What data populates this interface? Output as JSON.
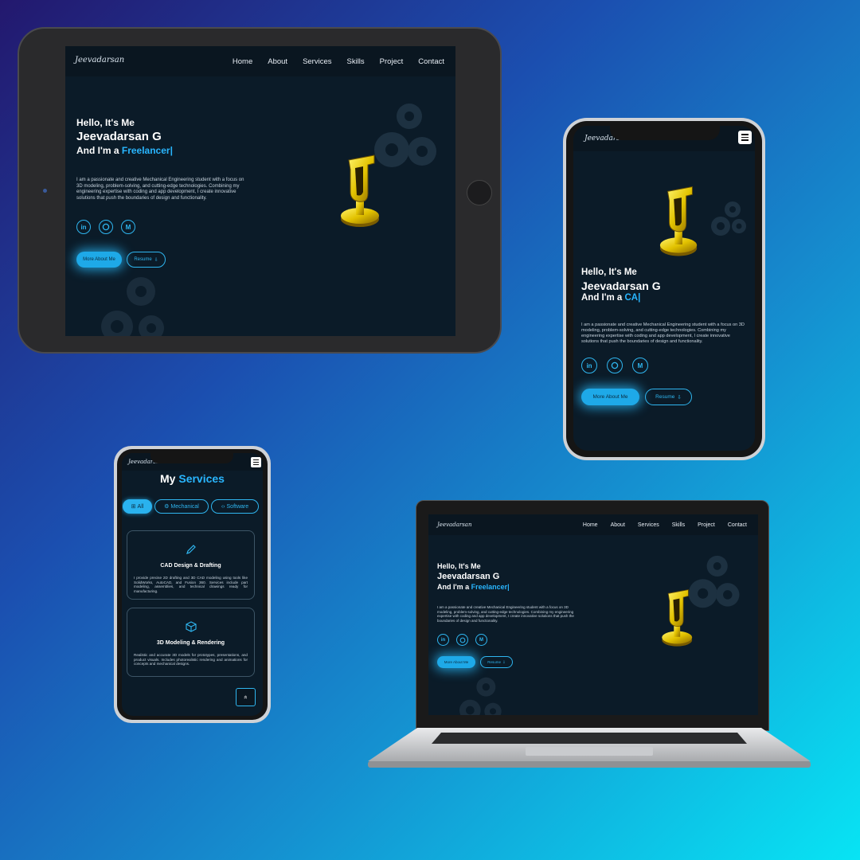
{
  "site": {
    "logo_text": "Jeevadarsan",
    "nav": [
      "Home",
      "About",
      "Services",
      "Skills",
      "Project",
      "Contact"
    ],
    "hello": "Hello, It's Me",
    "name": "Jeevadarsan G",
    "role_prefix": "And I'm a ",
    "role_tablet": "Freelancer|",
    "role_phone": "CA|",
    "role_laptop": "Freelancer|",
    "description": "I am a passionate and creative Mechanical Engineering student with a focus on 3D modeling, problem-solving, and cutting-edge technologies. Combining my engineering expertise with coding and app development, I create innovative solutions that push the boundaries of design and functionality.",
    "social": {
      "linkedin": "in",
      "github": "github-icon",
      "medium": "M"
    },
    "more_about_label": "More About Me",
    "resume_label": "Resume",
    "resume_icon": "⇩"
  },
  "services_page": {
    "title_prefix": "My ",
    "title_accent": "Services",
    "filters": [
      {
        "icon": "⊞",
        "label": "All"
      },
      {
        "icon": "⚙",
        "label": "Mechanical"
      },
      {
        "icon": "‹›",
        "label": "Software"
      }
    ],
    "cards": [
      {
        "icon": "pencil-icon",
        "title": "CAD Design & Drafting",
        "text": "I provide precise 2D drafting and 3D CAD modeling using tools like SolidWorks, AutoCAD, and Fusion 360. Services include part modeling, assemblies, and technical drawings ready for manufacturing."
      },
      {
        "icon": "cube-icon",
        "title": "3D Modeling & Rendering",
        "text": "Realistic and accurate 3D models for prototypes, presentations, and product visuals. Includes photorealistic rendering and animations for concepts and mechanical designs."
      }
    ],
    "scroll_top_icon": "»"
  },
  "colors": {
    "accent": "#29b6ff",
    "screen_bg": "#0b1b28",
    "button": "#1ea9e8"
  }
}
